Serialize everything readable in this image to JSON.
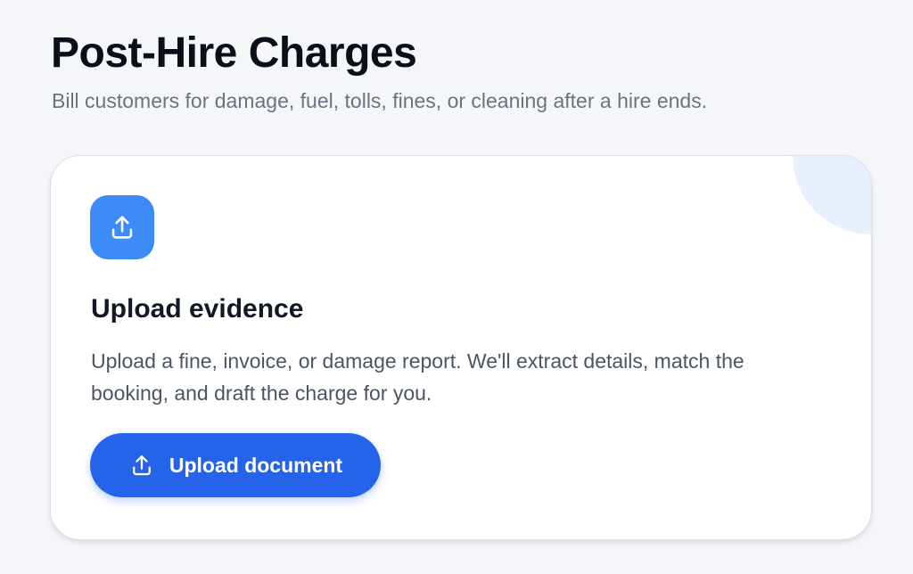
{
  "header": {
    "title": "Post-Hire Charges",
    "subtitle": "Bill customers for damage, fuel, tolls, fines, or cleaning after a hire ends."
  },
  "upload_card": {
    "icon": "upload-icon",
    "title": "Upload evidence",
    "description": "Upload a fine, invoice, or damage report. We'll extract details, match the booking, and draft the charge for you.",
    "button": {
      "label": "Upload document",
      "icon": "upload-icon"
    }
  },
  "colors": {
    "page_background": "#f5f6fa",
    "icon_tile": "#3d8bf7",
    "primary_button": "#2563eb",
    "corner_accent": "#e9f0fd",
    "title_text": "#0b0f1a",
    "muted_text": "#6b7280"
  }
}
